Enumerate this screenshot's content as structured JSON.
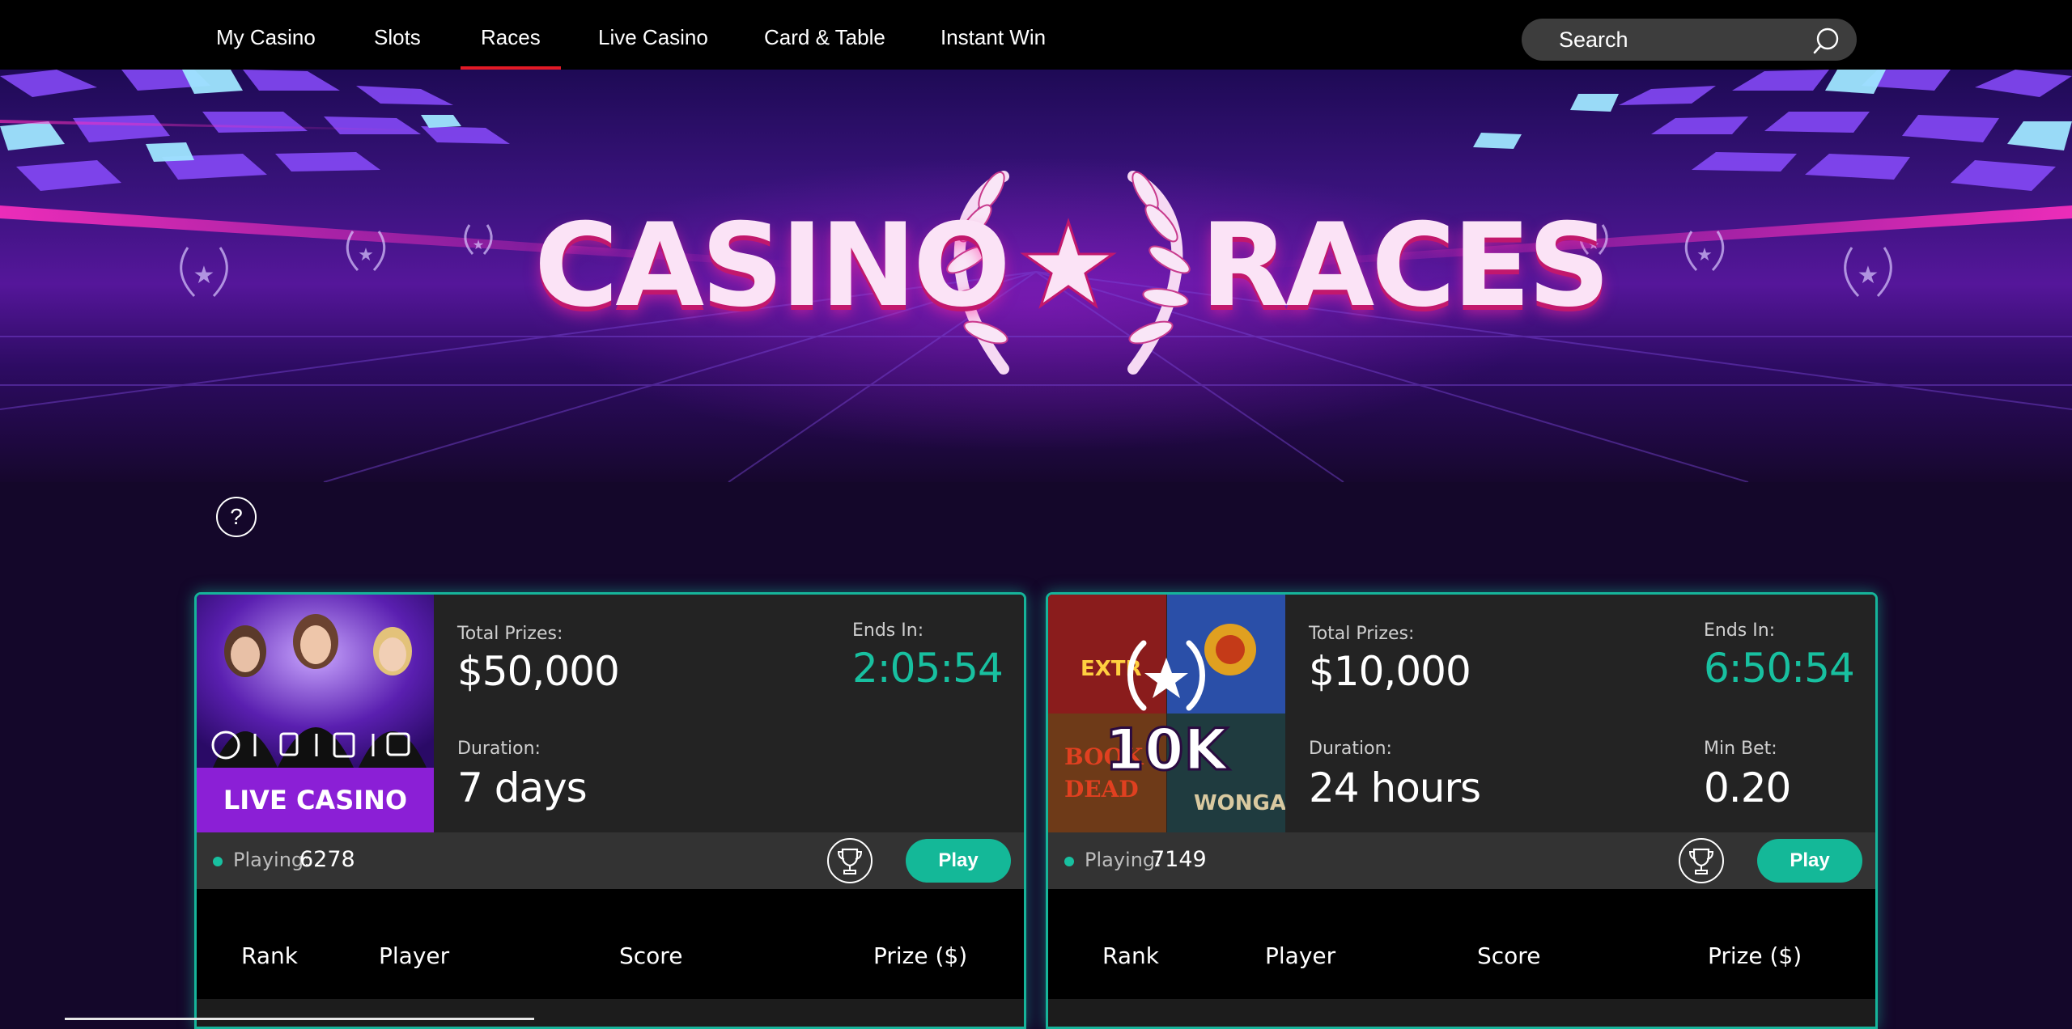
{
  "nav": {
    "items": [
      "My Casino",
      "Slots",
      "Races",
      "Live Casino",
      "Card & Table",
      "Instant Win"
    ],
    "active": "Races",
    "search_placeholder": "Search"
  },
  "hero": {
    "title_left": "CASINO",
    "title_right": "RACES"
  },
  "help": {
    "label": "?"
  },
  "races": [
    {
      "thumb_label": "LIVE CASINO",
      "total_prizes_label": "Total Prizes:",
      "total_prizes": "$50,000",
      "ends_in_label": "Ends In:",
      "ends_in": "2:05:54",
      "duration_label": "Duration:",
      "duration": "7 days",
      "playing_label": "Playing:",
      "playing": "6278",
      "play_label": "Play"
    },
    {
      "thumb_label": "10K",
      "total_prizes_label": "Total Prizes:",
      "total_prizes": "$10,000",
      "ends_in_label": "Ends In:",
      "ends_in": "6:50:54",
      "duration_label": "Duration:",
      "duration": "24 hours",
      "min_bet_label": "Min Bet:",
      "min_bet": "0.20",
      "playing_label": "Playing:",
      "playing": "7149",
      "play_label": "Play"
    }
  ],
  "table": {
    "columns": [
      "Rank",
      "Player",
      "Score",
      "Prize ($)"
    ]
  },
  "colors": {
    "accent": "#18c0a0",
    "nav_active": "#e21a25",
    "background": "#14072a"
  }
}
